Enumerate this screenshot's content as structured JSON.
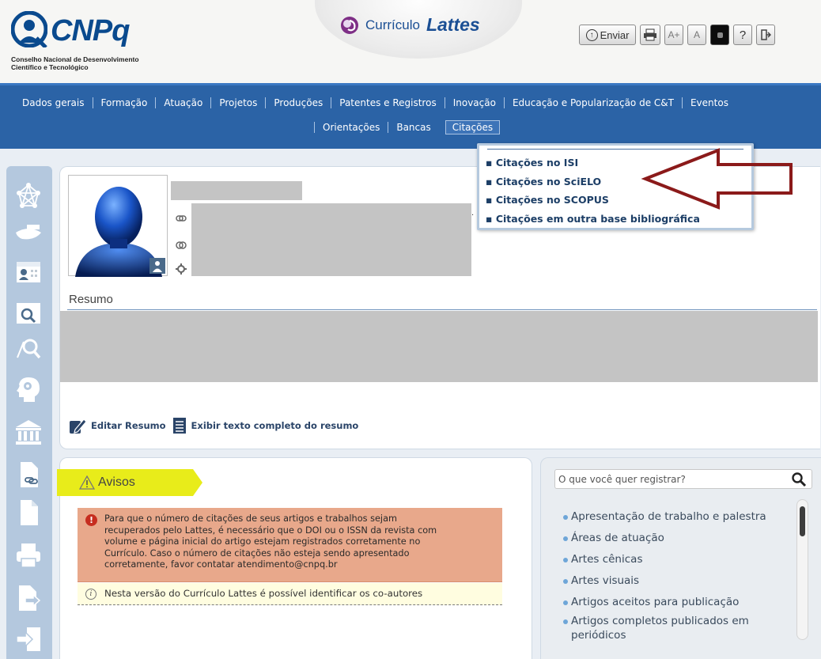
{
  "header": {
    "logo_text": "CNPq",
    "logo_subtitle_1": "Conselho Nacional de Desenvolvimento",
    "logo_subtitle_2": "Científico e Tecnológico",
    "app_title_prefix": "Currículo",
    "app_title_name": "Lattes"
  },
  "toolbar": {
    "send_label": "Enviar",
    "send_icon": "arrow-up-circle-icon",
    "font_increase": "A+",
    "font_normal": "A",
    "help": "?",
    "exit_icon": "exit-icon"
  },
  "nav": {
    "row1": [
      "Dados gerais",
      "Formação",
      "Atuação",
      "Projetos",
      "Produções",
      "Patentes e Registros",
      "Inovação",
      "Educação e Popularização de C&T",
      "Eventos"
    ],
    "row2": [
      "Orientações",
      "Bancas",
      "Citações"
    ],
    "active": "Citações"
  },
  "dropdown": {
    "items": [
      "Citações no ISI",
      "Citações no SciELO",
      "Citações no SCOPUS",
      "Citações em outra base bibliográfica"
    ]
  },
  "annotation": {
    "arrow_color": "#8b1a1a"
  },
  "sidebar": {
    "icons": [
      "network-icon",
      "hat-icon",
      "calendar-person-icon",
      "calendar-search-icon",
      "search-icon",
      "head-gears-icon",
      "institution-icon",
      "document-link-icon",
      "document-icon",
      "printer-icon",
      "document-arrow-icon",
      "login-icon"
    ]
  },
  "profile": {
    "resumo_title": "Resumo",
    "edit_resumo": "Editar Resumo",
    "show_full_resumo": "Exibir texto completo do resumo"
  },
  "avisos": {
    "title": "Avisos",
    "warning_lines": [
      "Para que o número de citações de seus artigos e trabalhos sejam",
      "recuperados pelo Lattes, é necessário que o DOI ou o ISSN da revista com",
      "volume e página inicial do artigo estejam registrados corretamente no",
      "Currículo. Caso o número de citações não esteja sendo apresentado",
      "corretamente, favor contatar atendimento@cnpq.br"
    ],
    "info": "Nesta versão do Currículo Lattes é possível identificar os co-autores"
  },
  "register": {
    "search_placeholder": "O que você quer registrar?",
    "items": [
      "Apresentação de trabalho e palestra",
      "Áreas de atuação",
      "Artes cênicas",
      "Artes visuais",
      "Artigos aceitos para publicação",
      "Artigos completos publicados em",
      "periódicos"
    ]
  },
  "colors": {
    "nav_blue": "#2b63a6",
    "sidebar_blue": "#b4c8de",
    "brand_blue": "#0a4a8e",
    "warning_bg": "#e8a88b",
    "info_bg": "#fffde0",
    "avisos_tag": "#e8ec1a"
  }
}
